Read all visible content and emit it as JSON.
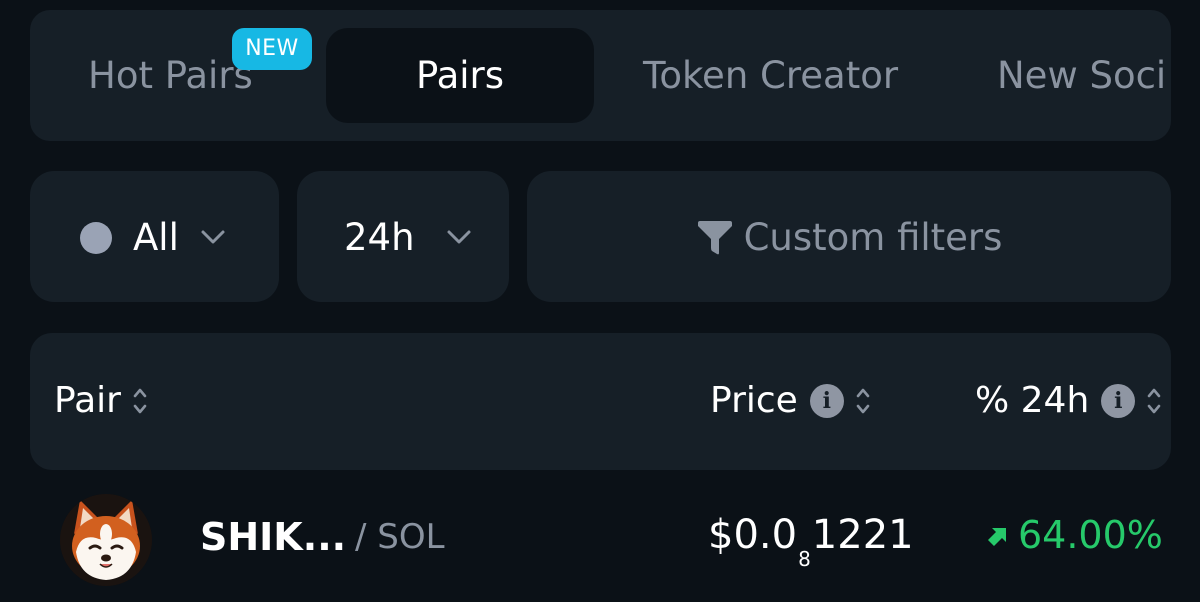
{
  "tabs": {
    "hot_pairs": "Hot Pairs",
    "new_badge": "NEW",
    "pairs": "Pairs",
    "token_creator": "Token Creator",
    "new_social": "New Soci"
  },
  "filters": {
    "chain": "All",
    "timeframe": "24h",
    "custom": "Custom filters"
  },
  "table": {
    "headers": {
      "pair": "Pair",
      "price": "Price",
      "change": "% 24h",
      "info_glyph": "i"
    },
    "rows": [
      {
        "name": "SHIK...",
        "quote": "/ SOL",
        "price_prefix": "$0.0",
        "price_zeros": "8",
        "price_digits": "1221",
        "change": "64.00%",
        "change_direction": "up",
        "avatar_icon": "shiba-inu-avatar"
      }
    ]
  },
  "colors": {
    "background": "#0b1117",
    "panel": "#161f27",
    "badge": "#17b8e4",
    "positive": "#26c96a",
    "muted_text": "#8a93a0"
  },
  "icons": {
    "chain_dot": "status-dot-icon",
    "dropdown": "chevron-down-icon",
    "filter": "funnel-icon",
    "sort": "sort-updown-icon",
    "info": "info-icon",
    "trend": "arrow-up-right-icon"
  }
}
